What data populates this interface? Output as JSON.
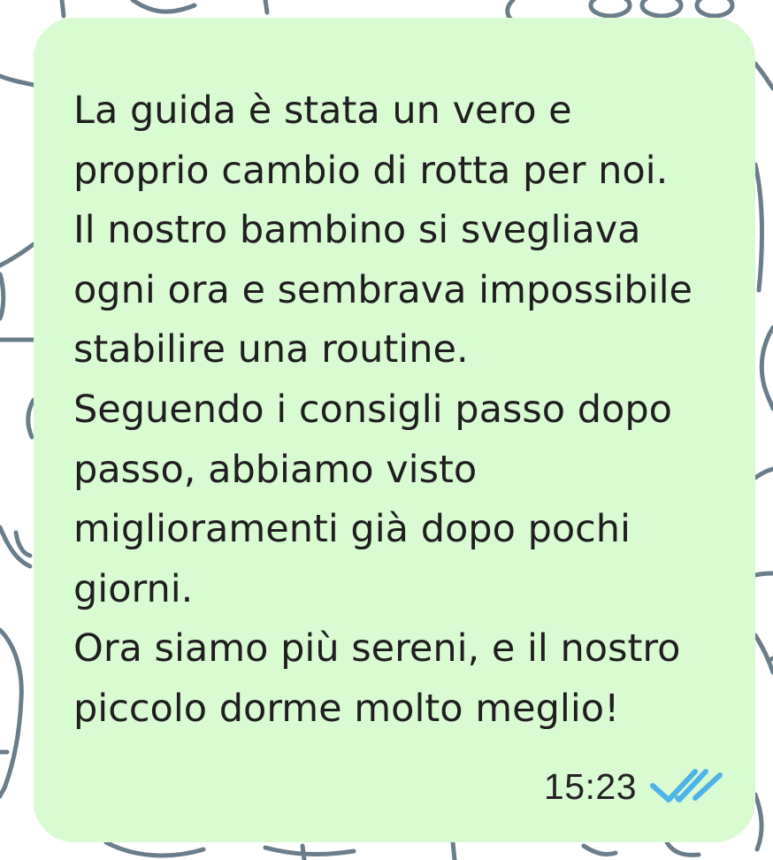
{
  "message": {
    "lines": [
      "La guida è stata un vero e",
      "proprio cambio di rotta per noi.",
      "Il nostro bambino si svegliava",
      "ogni ora e sembrava impossibile",
      "stabilire una routine.",
      "Seguendo i consigli passo dopo",
      "passo, abbiamo visto",
      "miglioramenti già dopo pochi",
      "giorni.",
      "Ora siamo più sereni, e il nostro",
      "piccolo dorme molto meglio!"
    ],
    "time": "15:23",
    "status_icon": "double-check-icon"
  },
  "colors": {
    "wallpaper": "#ffffff",
    "doodles": "#6a7d8a",
    "bubble": "#d9fbd2",
    "text": "#1f1f1f",
    "read_receipt": "#4fb3e8"
  }
}
